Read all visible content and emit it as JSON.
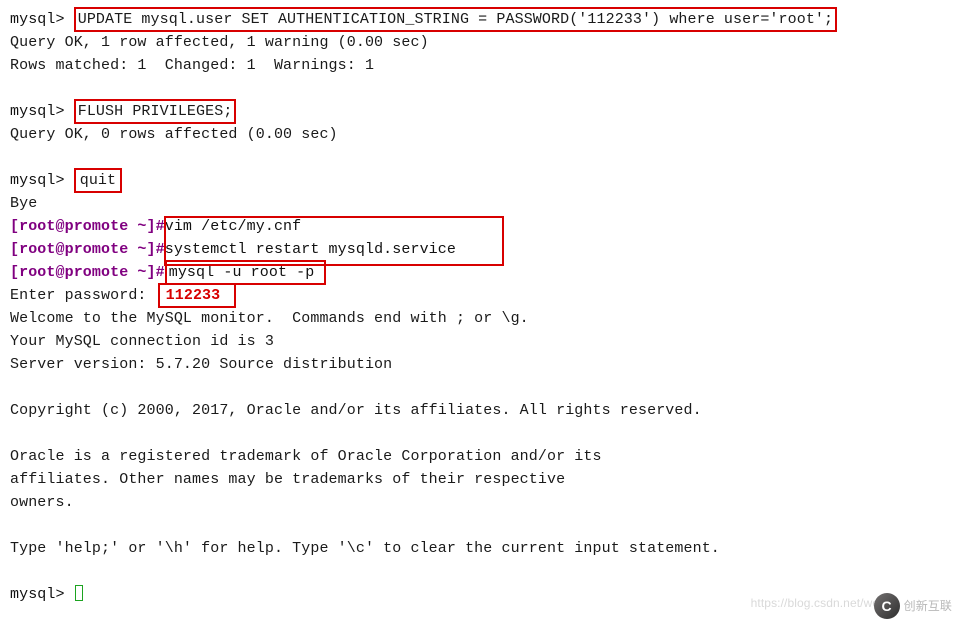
{
  "prompts": {
    "mysql": "mysql>",
    "shell": "[root@promote ~]#"
  },
  "sql": {
    "update": "UPDATE mysql.user SET AUTHENTICATION_STRING = PASSWORD('112233') where user='root';",
    "update_result1": "Query OK, 1 row affected, 1 warning (0.00 sec)",
    "update_result2": "Rows matched: 1  Changed: 1  Warnings: 1",
    "flush": "FLUSH PRIVILEGES;",
    "flush_result": "Query OK, 0 rows affected (0.00 sec)",
    "quit": "quit",
    "bye": "Bye"
  },
  "shell": {
    "cmd1": "vim /etc/my.cnf",
    "cmd2": "systemctl restart mysqld.service",
    "cmd3": "mysql -u root -p"
  },
  "login": {
    "enter_pw": "Enter password:",
    "password": "112233",
    "welcome": "Welcome to the MySQL monitor.  Commands end with ; or \\g.",
    "connid": "Your MySQL connection id is 3",
    "version": "Server version: 5.7.20 Source distribution",
    "copyright": "Copyright (c) 2000, 2017, Oracle and/or its affiliates. All rights reserved.",
    "trademark1": "Oracle is a registered trademark of Oracle Corporation and/or its",
    "trademark2": "affiliates. Other names may be trademarks of their respective",
    "trademark3": "owners.",
    "help": "Type 'help;' or '\\h' for help. Type '\\c' to clear the current input statement."
  },
  "watermark": {
    "url": "https://blog.csdn.net/weix",
    "brand": "创新互联"
  }
}
